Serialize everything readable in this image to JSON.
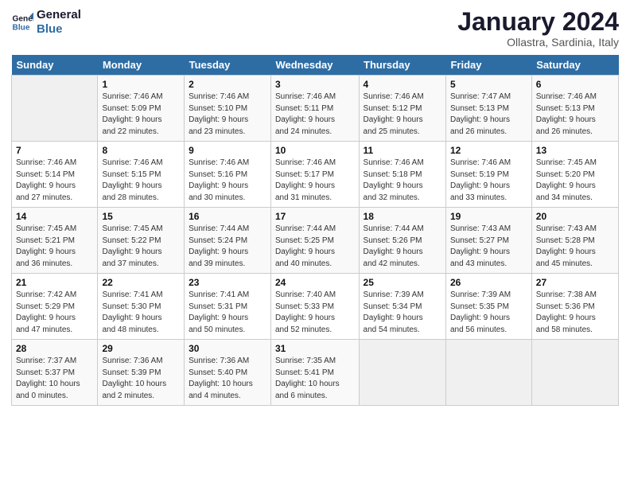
{
  "logo": {
    "line1": "General",
    "line2": "Blue"
  },
  "title": "January 2024",
  "subtitle": "Ollastra, Sardinia, Italy",
  "days_header": [
    "Sunday",
    "Monday",
    "Tuesday",
    "Wednesday",
    "Thursday",
    "Friday",
    "Saturday"
  ],
  "weeks": [
    [
      {
        "day": "",
        "info": ""
      },
      {
        "day": "1",
        "info": "Sunrise: 7:46 AM\nSunset: 5:09 PM\nDaylight: 9 hours\nand 22 minutes."
      },
      {
        "day": "2",
        "info": "Sunrise: 7:46 AM\nSunset: 5:10 PM\nDaylight: 9 hours\nand 23 minutes."
      },
      {
        "day": "3",
        "info": "Sunrise: 7:46 AM\nSunset: 5:11 PM\nDaylight: 9 hours\nand 24 minutes."
      },
      {
        "day": "4",
        "info": "Sunrise: 7:46 AM\nSunset: 5:12 PM\nDaylight: 9 hours\nand 25 minutes."
      },
      {
        "day": "5",
        "info": "Sunrise: 7:47 AM\nSunset: 5:13 PM\nDaylight: 9 hours\nand 26 minutes."
      },
      {
        "day": "6",
        "info": "Sunrise: 7:46 AM\nSunset: 5:13 PM\nDaylight: 9 hours\nand 26 minutes."
      }
    ],
    [
      {
        "day": "7",
        "info": "Sunrise: 7:46 AM\nSunset: 5:14 PM\nDaylight: 9 hours\nand 27 minutes."
      },
      {
        "day": "8",
        "info": "Sunrise: 7:46 AM\nSunset: 5:15 PM\nDaylight: 9 hours\nand 28 minutes."
      },
      {
        "day": "9",
        "info": "Sunrise: 7:46 AM\nSunset: 5:16 PM\nDaylight: 9 hours\nand 30 minutes."
      },
      {
        "day": "10",
        "info": "Sunrise: 7:46 AM\nSunset: 5:17 PM\nDaylight: 9 hours\nand 31 minutes."
      },
      {
        "day": "11",
        "info": "Sunrise: 7:46 AM\nSunset: 5:18 PM\nDaylight: 9 hours\nand 32 minutes."
      },
      {
        "day": "12",
        "info": "Sunrise: 7:46 AM\nSunset: 5:19 PM\nDaylight: 9 hours\nand 33 minutes."
      },
      {
        "day": "13",
        "info": "Sunrise: 7:45 AM\nSunset: 5:20 PM\nDaylight: 9 hours\nand 34 minutes."
      }
    ],
    [
      {
        "day": "14",
        "info": "Sunrise: 7:45 AM\nSunset: 5:21 PM\nDaylight: 9 hours\nand 36 minutes."
      },
      {
        "day": "15",
        "info": "Sunrise: 7:45 AM\nSunset: 5:22 PM\nDaylight: 9 hours\nand 37 minutes."
      },
      {
        "day": "16",
        "info": "Sunrise: 7:44 AM\nSunset: 5:24 PM\nDaylight: 9 hours\nand 39 minutes."
      },
      {
        "day": "17",
        "info": "Sunrise: 7:44 AM\nSunset: 5:25 PM\nDaylight: 9 hours\nand 40 minutes."
      },
      {
        "day": "18",
        "info": "Sunrise: 7:44 AM\nSunset: 5:26 PM\nDaylight: 9 hours\nand 42 minutes."
      },
      {
        "day": "19",
        "info": "Sunrise: 7:43 AM\nSunset: 5:27 PM\nDaylight: 9 hours\nand 43 minutes."
      },
      {
        "day": "20",
        "info": "Sunrise: 7:43 AM\nSunset: 5:28 PM\nDaylight: 9 hours\nand 45 minutes."
      }
    ],
    [
      {
        "day": "21",
        "info": "Sunrise: 7:42 AM\nSunset: 5:29 PM\nDaylight: 9 hours\nand 47 minutes."
      },
      {
        "day": "22",
        "info": "Sunrise: 7:41 AM\nSunset: 5:30 PM\nDaylight: 9 hours\nand 48 minutes."
      },
      {
        "day": "23",
        "info": "Sunrise: 7:41 AM\nSunset: 5:31 PM\nDaylight: 9 hours\nand 50 minutes."
      },
      {
        "day": "24",
        "info": "Sunrise: 7:40 AM\nSunset: 5:33 PM\nDaylight: 9 hours\nand 52 minutes."
      },
      {
        "day": "25",
        "info": "Sunrise: 7:39 AM\nSunset: 5:34 PM\nDaylight: 9 hours\nand 54 minutes."
      },
      {
        "day": "26",
        "info": "Sunrise: 7:39 AM\nSunset: 5:35 PM\nDaylight: 9 hours\nand 56 minutes."
      },
      {
        "day": "27",
        "info": "Sunrise: 7:38 AM\nSunset: 5:36 PM\nDaylight: 9 hours\nand 58 minutes."
      }
    ],
    [
      {
        "day": "28",
        "info": "Sunrise: 7:37 AM\nSunset: 5:37 PM\nDaylight: 10 hours\nand 0 minutes."
      },
      {
        "day": "29",
        "info": "Sunrise: 7:36 AM\nSunset: 5:39 PM\nDaylight: 10 hours\nand 2 minutes."
      },
      {
        "day": "30",
        "info": "Sunrise: 7:36 AM\nSunset: 5:40 PM\nDaylight: 10 hours\nand 4 minutes."
      },
      {
        "day": "31",
        "info": "Sunrise: 7:35 AM\nSunset: 5:41 PM\nDaylight: 10 hours\nand 6 minutes."
      },
      {
        "day": "",
        "info": ""
      },
      {
        "day": "",
        "info": ""
      },
      {
        "day": "",
        "info": ""
      }
    ]
  ]
}
